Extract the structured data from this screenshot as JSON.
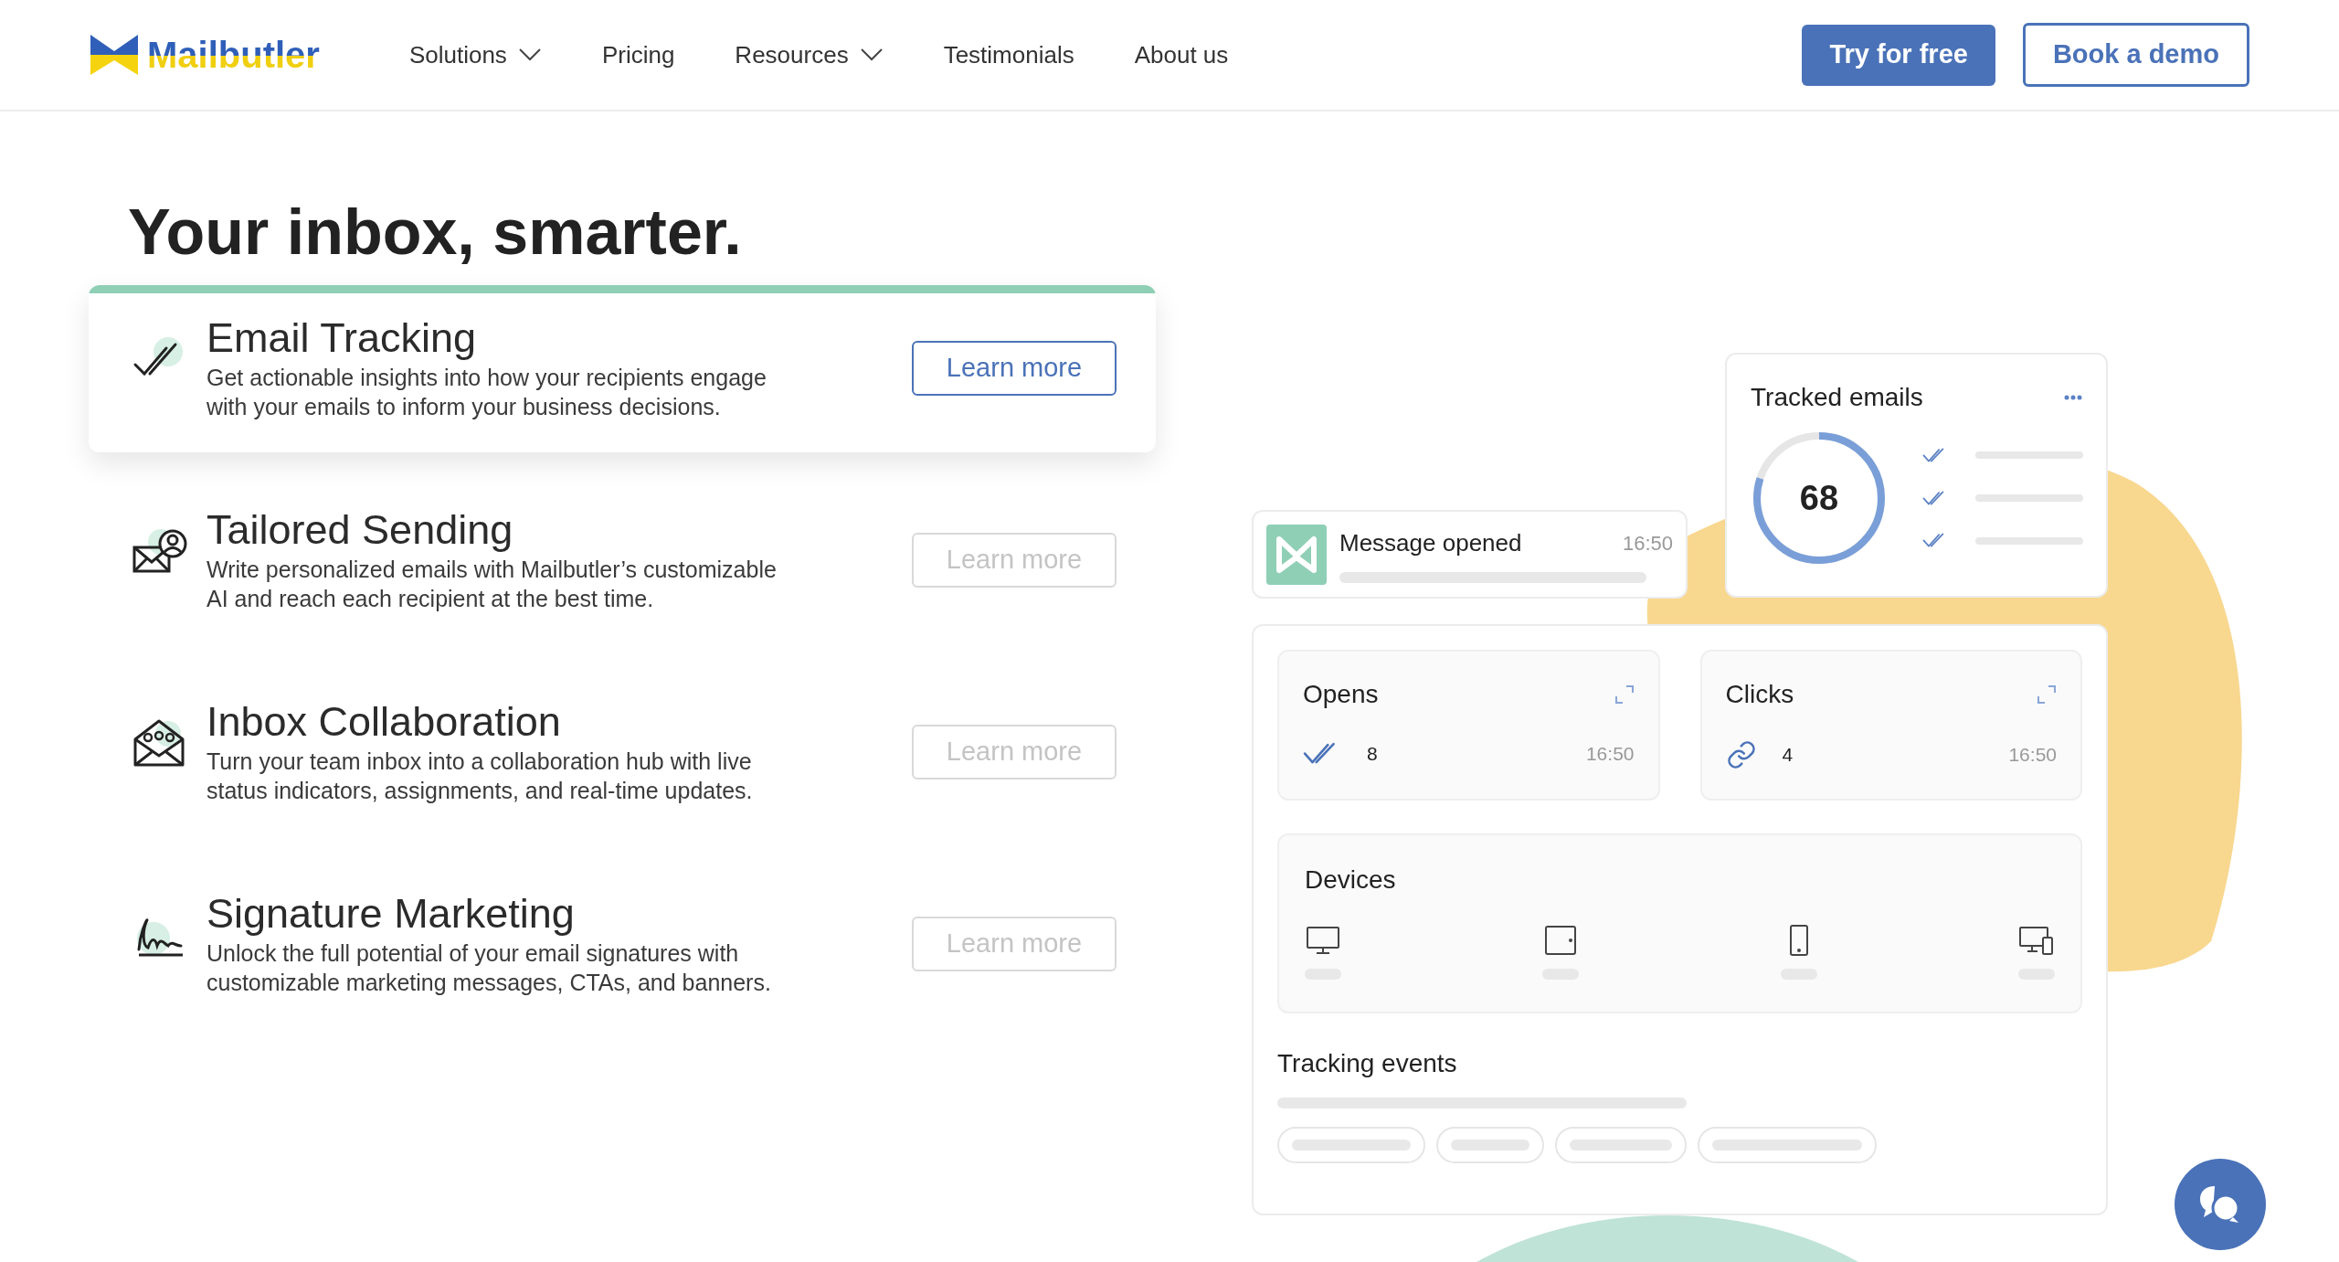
{
  "header": {
    "logo": "Mailbutler",
    "nav": [
      {
        "label": "Solutions",
        "dropdown": true
      },
      {
        "label": "Pricing",
        "dropdown": false
      },
      {
        "label": "Resources",
        "dropdown": true
      },
      {
        "label": "Testimonials",
        "dropdown": false
      },
      {
        "label": "About us",
        "dropdown": false
      }
    ],
    "buttons": [
      {
        "label": "Try for free",
        "kind": "primary"
      },
      {
        "label": "Book a demo",
        "kind": "outline"
      }
    ]
  },
  "hero": {
    "title": "Your inbox, smarter."
  },
  "features": [
    {
      "kind": "tracking",
      "title": "Email Tracking",
      "description": "Get actionable insights into how your recipients engage with your emails to inform your business decisions.",
      "button": "Learn more",
      "selected": true
    },
    {
      "kind": "sending",
      "title": "Tailored Sending",
      "description": "Write personalized emails with Mailbutler’s customizable AI and reach each recipient at the best time.",
      "button": "Learn more",
      "selected": false
    },
    {
      "kind": "collaboration",
      "title": "Inbox Collaboration",
      "description": "Turn your team inbox into a collaboration hub with live status indicators, assignments, and real-time updates.",
      "button": "Learn more",
      "selected": false
    },
    {
      "kind": "signature",
      "title": "Signature Marketing",
      "description": "Unlock the full potential of your email signatures with customizable marketing messages, CTAs, and banners.",
      "button": "Learn more",
      "selected": false
    }
  ],
  "dashboard": {
    "notification": {
      "title": "Message opened",
      "time": "16:50"
    },
    "tracked": {
      "title": "Tracked emails",
      "count": "68",
      "level": 0.8
    },
    "stats": [
      {
        "kind": "opens",
        "title": "Opens",
        "count": "8",
        "time": "16:50"
      },
      {
        "kind": "clicks",
        "title": "Clicks",
        "count": "4",
        "time": "16:50"
      }
    ],
    "devices": {
      "title": "Devices"
    },
    "events": {
      "title": "Tracking events"
    }
  }
}
